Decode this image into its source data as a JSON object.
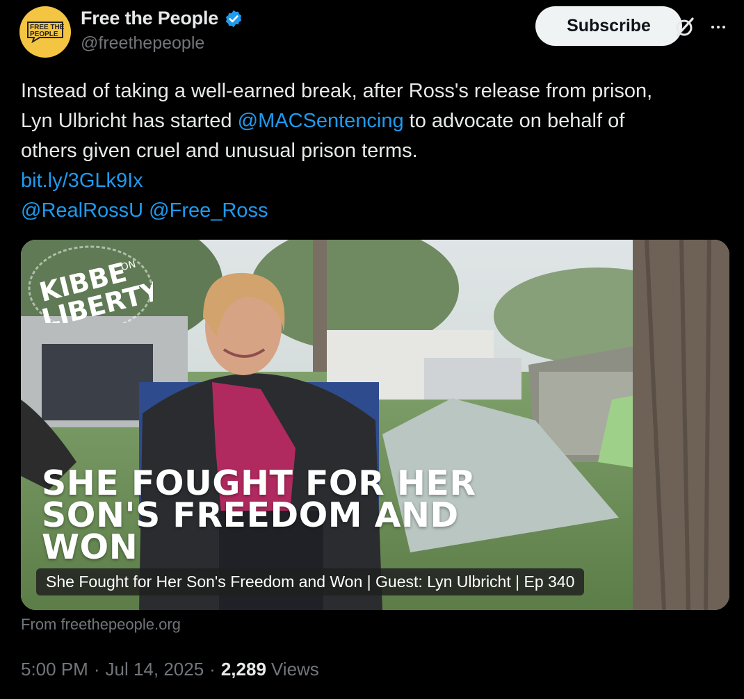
{
  "author": {
    "avatar_text_line1": "FREE THE",
    "avatar_text_line2": "PEOPLE",
    "display_name": "Free the People",
    "handle": "@freethepeople",
    "avatar_color": "#f4c542",
    "verified_color": "#1d9bf0"
  },
  "actions": {
    "subscribe_label": "Subscribe",
    "grok_icon": "grok-icon",
    "more_icon": "more-icon"
  },
  "post": {
    "line1": "Instead of taking a well-earned break, after Ross's release from prison,",
    "line2_pre": "Lyn Ulbricht has started ",
    "line2_mention": "@MACSentencing",
    "line2_post": " to advocate on behalf of",
    "line3": "others given cruel and unusual prison terms.",
    "url": "bit.ly/3GLk9Ix",
    "mention1": "@RealRossU",
    "mention2": "@Free_Ross",
    "link_color": "#1d9bf0"
  },
  "card": {
    "headline_line1": "SHE FOUGHT FOR HER",
    "headline_line2": "SON'S FREEDOM AND",
    "headline_line3": "WON",
    "caption": "She Fought for Her Son's Freedom and Won | Guest: Lyn Ulbricht | Ep 340",
    "brand_top": "KIBBE",
    "brand_on": "ON",
    "brand_bottom": "LIBERTY",
    "source": "From freethepeople.org"
  },
  "meta": {
    "time": "5:00 PM",
    "date": "Jul 14, 2025",
    "views_count": "2,289",
    "views_label": "Views"
  }
}
